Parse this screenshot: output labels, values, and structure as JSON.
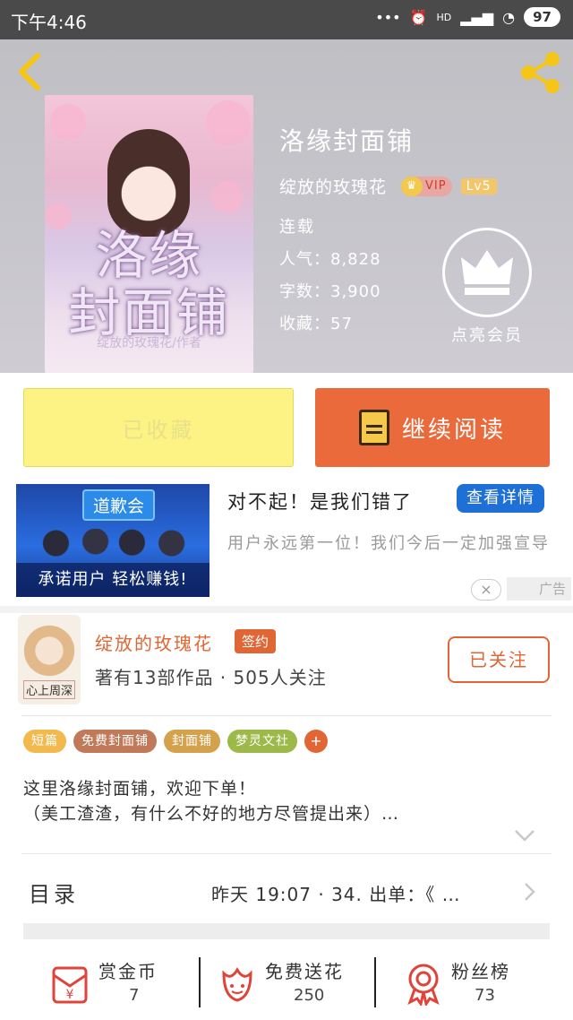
{
  "status_bar": {
    "time": "下午4:46",
    "network": "HD",
    "battery": "97"
  },
  "book": {
    "title": "洛缘封面铺",
    "cover_title_line1": "洛缘",
    "cover_title_line2": "封面铺",
    "cover_author": "绽放的玫瑰花/作者",
    "author": "绽放的玫瑰花",
    "vip": "VIP",
    "level": "Lv5",
    "status": "连载",
    "popularity": "人气：8,828",
    "word_count": "字数：3,900",
    "favorites": "收藏：57"
  },
  "member": {
    "label": "点亮会员"
  },
  "actions": {
    "collected": "已收藏",
    "continue": "继续阅读"
  },
  "ad": {
    "image_tag": "道歉会",
    "image_slogan": "承诺用户 轻松赚钱!",
    "headline": "对不起！是我们错了",
    "detail_button": "查看详情",
    "description": "用户永远第一位！我们今后一定加强宣导",
    "close": "×",
    "label": "广告"
  },
  "author_card": {
    "name": "绽放的玫瑰花",
    "signed": "签约",
    "meta": "著有13部作品 · 505人关注",
    "follow": "已关注",
    "avatar_caption": "心上周深"
  },
  "tags": [
    {
      "label": "短篇",
      "color": "#f2b94c"
    },
    {
      "label": "免费封面铺",
      "color": "#c07a5a"
    },
    {
      "label": "封面铺",
      "color": "#d4a24c"
    },
    {
      "label": "梦灵文社",
      "color": "#9cb94a"
    }
  ],
  "tag_more": "+",
  "description": "这里洛缘封面铺，欢迎下单！\n（美工渣渣，有什么不好的地方尽管提出来）…",
  "catalog": {
    "label": "目录",
    "latest": "昨天 19:07 · 34. 出单：《 …"
  },
  "bottom": [
    {
      "label": "赏金币",
      "value": "7",
      "icon": "red-envelope-icon"
    },
    {
      "label": "免费送花",
      "value": "250",
      "icon": "flower-icon"
    },
    {
      "label": "粉丝榜",
      "value": "73",
      "icon": "medal-icon"
    }
  ],
  "colors": {
    "accent": "#e06735",
    "collect_bg": "#fcf384",
    "read_bg": "#ea6a3b",
    "ad_button": "#1e6fd6"
  }
}
